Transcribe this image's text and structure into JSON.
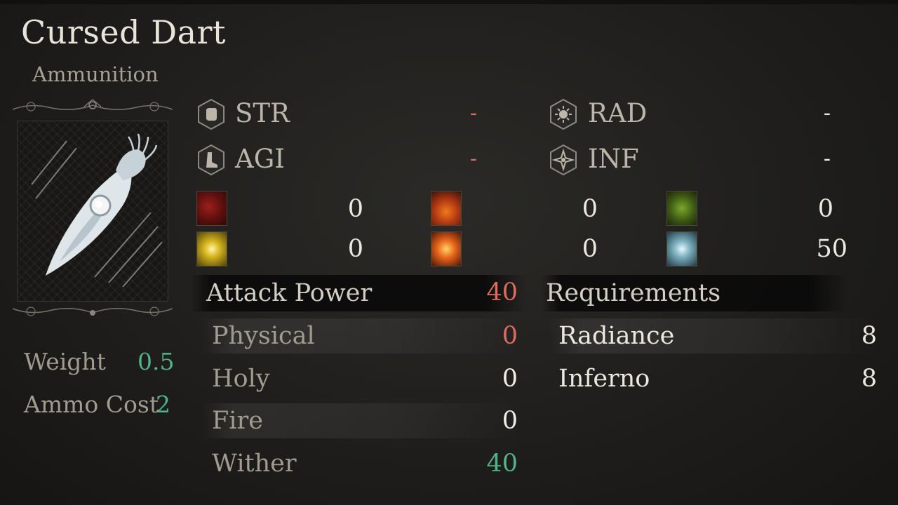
{
  "item": {
    "name": "Cursed Dart",
    "category": "Ammunition"
  },
  "side": {
    "weight_label": "Weight",
    "weight_value": "0.5",
    "ammo_cost_label": "Ammo Cost",
    "ammo_cost_value": "2"
  },
  "scaling": [
    {
      "icon": "strength-fist-icon",
      "name": "STR",
      "value": "-"
    },
    {
      "icon": "agility-boot-icon",
      "name": "AGI",
      "value": "-"
    },
    {
      "icon": "radiance-sun-icon",
      "name": "RAD",
      "value": "-"
    },
    {
      "icon": "inferno-star-icon",
      "name": "INF",
      "value": "-"
    }
  ],
  "affinities": [
    {
      "icon": "bleed-icon",
      "value": "0"
    },
    {
      "icon": "burn-icon",
      "value": "0"
    },
    {
      "icon": "poison-icon",
      "value": "0"
    },
    {
      "icon": "holy-light-icon",
      "value": "0"
    },
    {
      "icon": "explosion-icon",
      "value": "0"
    },
    {
      "icon": "wither-frost-icon",
      "value": "50"
    }
  ],
  "attack": {
    "header": "Attack Power",
    "total": "40",
    "rows": [
      {
        "label": "Physical",
        "value": "0"
      },
      {
        "label": "Holy",
        "value": "0"
      },
      {
        "label": "Fire",
        "value": "0"
      },
      {
        "label": "Wither",
        "value": "40"
      }
    ]
  },
  "requirements": {
    "header": "Requirements",
    "rows": [
      {
        "label": "Radiance",
        "value": "8"
      },
      {
        "label": "Inferno",
        "value": "8"
      }
    ]
  },
  "colors": {
    "positive": "#4fb487",
    "negative": "#df6a5f",
    "text": "#cfcac0"
  }
}
